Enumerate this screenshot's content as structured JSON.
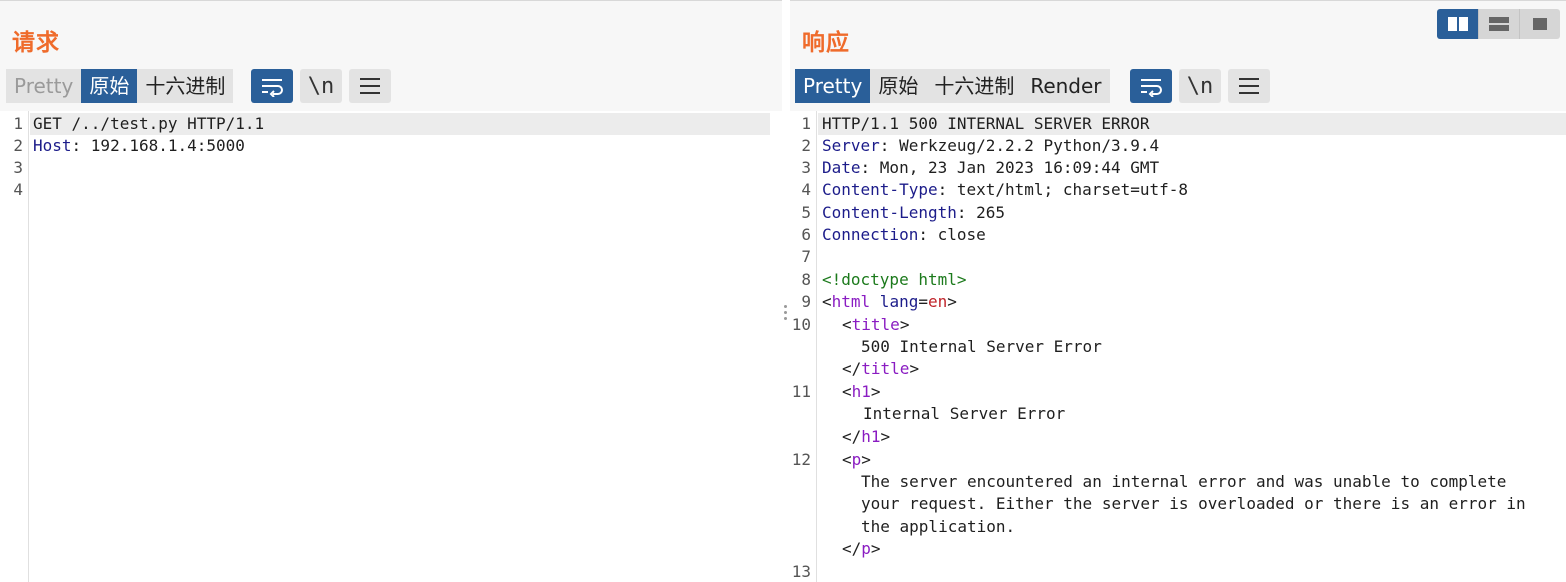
{
  "request": {
    "title": "请求",
    "tabs": [
      "Pretty",
      "原始",
      "十六进制"
    ],
    "newline_label": "\\n",
    "line_numbers": [
      "1",
      "2",
      "3",
      "4"
    ],
    "lines": [
      {
        "plain": "GET /../test.py HTTP/1.1"
      },
      {
        "key": "Host",
        "value": ": 192.168.1.4:5000"
      }
    ]
  },
  "response": {
    "title": "响应",
    "tabs": [
      "Pretty",
      "原始",
      "十六进制",
      "Render"
    ],
    "newline_label": "\\n",
    "line_numbers": [
      "1",
      "2",
      "3",
      "4",
      "5",
      "6",
      "7",
      "8",
      "9",
      "10",
      "11",
      "12",
      "13"
    ],
    "status_line": "HTTP/1.1 500 INTERNAL SERVER ERROR",
    "headers": [
      {
        "key": "Server",
        "value": ": Werkzeug/2.2.2 Python/3.9.4"
      },
      {
        "key": "Date",
        "value": ": Mon, 23 Jan 2023 16:09:44 GMT"
      },
      {
        "key": "Content-Type",
        "value": ": text/html; charset=utf-8"
      },
      {
        "key": "Content-Length",
        "value": ": 265"
      },
      {
        "key": "Connection",
        "value": ": close"
      }
    ],
    "body": {
      "doctype": "<!doctype html>",
      "html_open_lt": "<",
      "html_tag": "html",
      "lang_attr": " lang",
      "eq": "=",
      "lang_val": "en",
      "gt": ">",
      "lt": "<",
      "close_lt": "</",
      "title_tag": "title",
      "title_text": "500 Internal Server Error",
      "h1_tag": "h1",
      "h1_text": "Internal Server Error",
      "p_tag": "p",
      "p_lines": [
        "The server encountered an internal error and was unable to complete",
        "your request. Either the server is overloaded or there is an error in",
        "the application."
      ]
    }
  },
  "colors": {
    "accent": "#2a5f99",
    "title_orange": "#ef6b2b",
    "header_key": "#1c1c8a",
    "html_tag": "#8a1cc2",
    "doctype": "#1c7a1c",
    "attr_value": "#c0242a"
  },
  "icons": {
    "wrap": "wrap-icon",
    "menu": "hamburger-menu-icon",
    "layout": [
      "side-by-side-layout-icon",
      "stacked-layout-icon",
      "single-pane-layout-icon"
    ]
  }
}
